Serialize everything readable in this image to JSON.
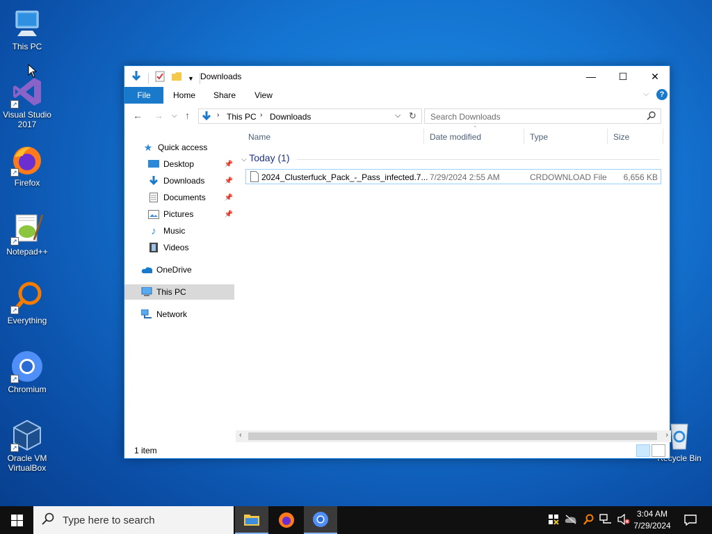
{
  "desktop": {
    "icons": [
      {
        "label": "This PC"
      },
      {
        "label": "Visual Studio 2017"
      },
      {
        "label": "Firefox"
      },
      {
        "label": "Notepad++"
      },
      {
        "label": "Everything"
      },
      {
        "label": "Chromium"
      },
      {
        "label": "Oracle VM VirtualBox"
      },
      {
        "label": "Recycle Bin"
      }
    ]
  },
  "explorer": {
    "title": "Downloads",
    "ribbon_tabs": [
      "File",
      "Home",
      "Share",
      "View"
    ],
    "address": {
      "segments": [
        "This PC",
        "Downloads"
      ]
    },
    "search_placeholder": "Search Downloads",
    "nav": {
      "quick_access": "Quick access",
      "pinned": [
        "Desktop",
        "Downloads",
        "Documents",
        "Pictures"
      ],
      "unpinned": [
        "Music",
        "Videos"
      ],
      "onedrive": "OneDrive",
      "this_pc": "This PC",
      "network": "Network"
    },
    "columns": [
      "Name",
      "Date modified",
      "Type",
      "Size"
    ],
    "group": "Today (1)",
    "files": [
      {
        "name": "2024_Clusterfuck_Pack_-_Pass_infected.7...",
        "date": "7/29/2024 2:55 AM",
        "type": "CRDOWNLOAD File",
        "size": "6,656 KB"
      }
    ],
    "status": "1 item"
  },
  "taskbar": {
    "search_placeholder": "Type here to search",
    "time": "3:04 AM",
    "date": "7/29/2024"
  },
  "colors": {
    "accent": "#1979ca",
    "selection_border": "#99d1ff",
    "taskbar": "#101010"
  }
}
